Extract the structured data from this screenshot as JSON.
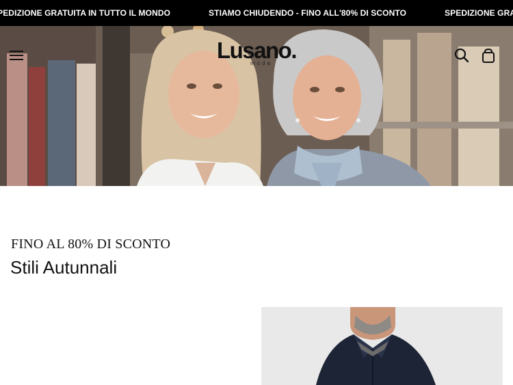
{
  "announcement": {
    "items": [
      "SPEDIZIONE GRATUITA IN TUTTO IL MONDO",
      "STIAMO CHIUDENDO - FINO ALL'80% DI SCONTO",
      "SPEDIZIONE GRATUITA IN TUTTO IL MONDO"
    ]
  },
  "header": {
    "logo": "Lusano.",
    "logo_sub": "moda",
    "menu_icon": "menu-icon",
    "search_icon": "search-icon",
    "bag_icon": "shopping-bag-icon"
  },
  "promo": {
    "eyebrow": "FINO AL 80% DI SCONTO",
    "headline": "Stili Autunnali"
  },
  "colors": {
    "announcement_bg": "#000000",
    "announcement_text": "#ffffff",
    "text": "#111111",
    "card_bg": "#e9e9e9"
  }
}
